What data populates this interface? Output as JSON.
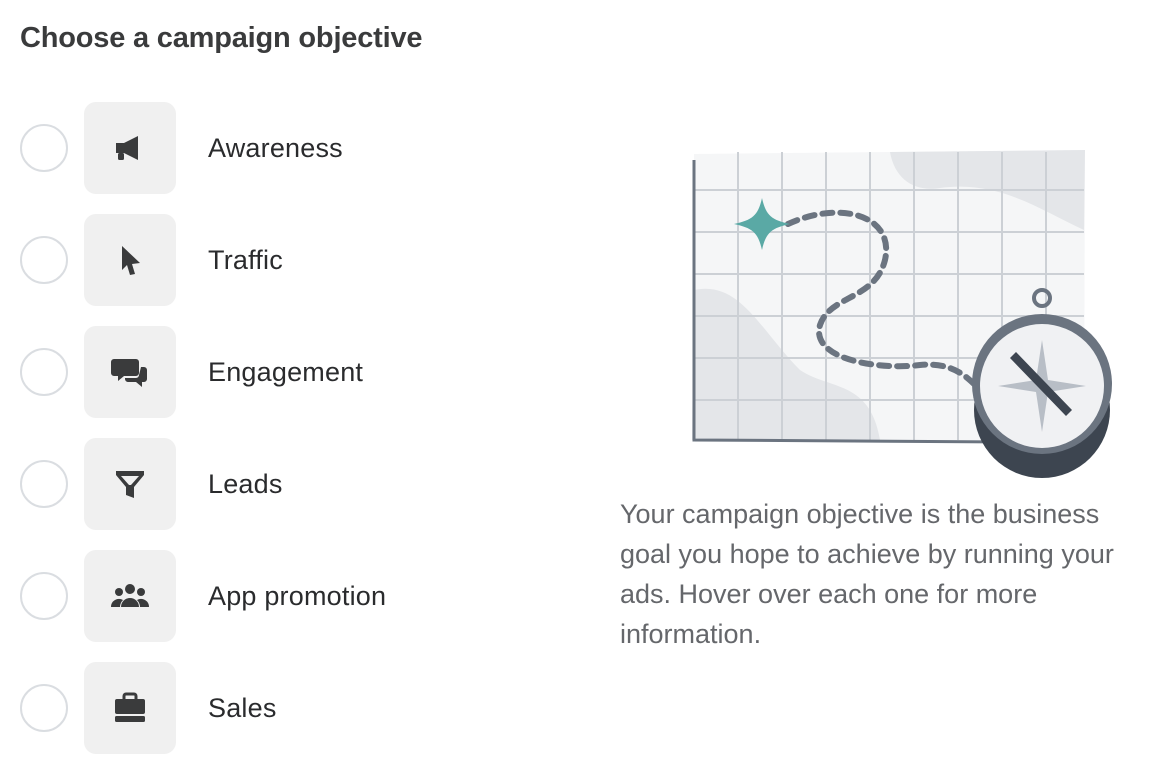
{
  "header": {
    "title": "Choose a campaign objective"
  },
  "objectives": [
    {
      "label": "Awareness",
      "icon": "megaphone-icon"
    },
    {
      "label": "Traffic",
      "icon": "cursor-icon"
    },
    {
      "label": "Engagement",
      "icon": "chat-bubbles-icon"
    },
    {
      "label": "Leads",
      "icon": "funnel-icon"
    },
    {
      "label": "App promotion",
      "icon": "people-icon"
    },
    {
      "label": "Sales",
      "icon": "briefcase-icon"
    }
  ],
  "info": {
    "description": "Your campaign objective is the business goal you hope to achieve by running your ads. Hover over each one for more information.",
    "illustration_icon": "map-compass-icon"
  },
  "colors": {
    "icon": "#3a3b3c",
    "icon_bg": "#f0f0f0",
    "radio_border": "#dadde1",
    "accent_star": "#5aa9a5",
    "description_text": "#65676b"
  }
}
